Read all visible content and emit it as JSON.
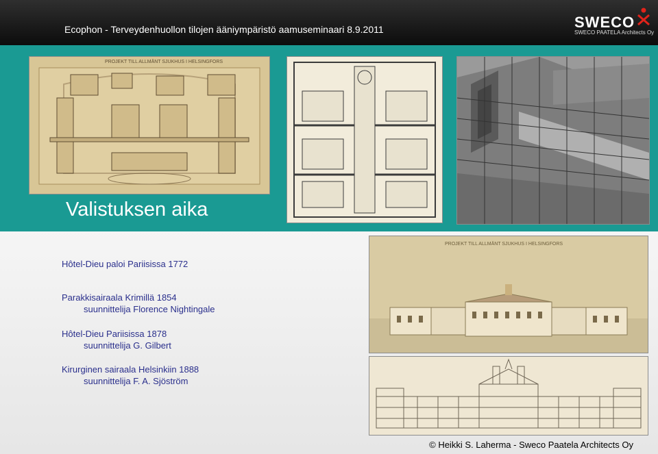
{
  "header": {
    "title": "Ecophon - Terveydenhuollon tilojen ääniympäristö aamuseminaari 8.9.2011",
    "logo_text": "SWECO",
    "logo_subtext": "SWECO PAATELA Architects Oy"
  },
  "section_title": "Valistuksen aika",
  "items": [
    {
      "line1": "Hôtel-Dieu paloi Pariisissa 1772",
      "line2": ""
    },
    {
      "line1": "Parakkisairaala Krimillä 1854",
      "line2": "suunnittelija Florence Nightingale"
    },
    {
      "line1": "Hôtel-Dieu Pariisissa 1878",
      "line2": "suunnittelija G. Gilbert"
    },
    {
      "line1": "Kirurginen sairaala Helsinkiin 1888",
      "line2": "suunnittelija F. A. Sjöström"
    }
  ],
  "images": {
    "site_plan_caption": "PROJEKT TILL ALLMÄNT SJUKHUS I HELSINGFORS",
    "facade_caption": "PROJEKT TILL ALLMÄNT SJUKHUS I HELSINGFORS"
  },
  "footer": "© Heikki S. Laherma - Sweco Paatela Architects Oy",
  "colors": {
    "header": "#111111",
    "teal": "#1a9a93",
    "body_text": "#2a2f8c"
  }
}
